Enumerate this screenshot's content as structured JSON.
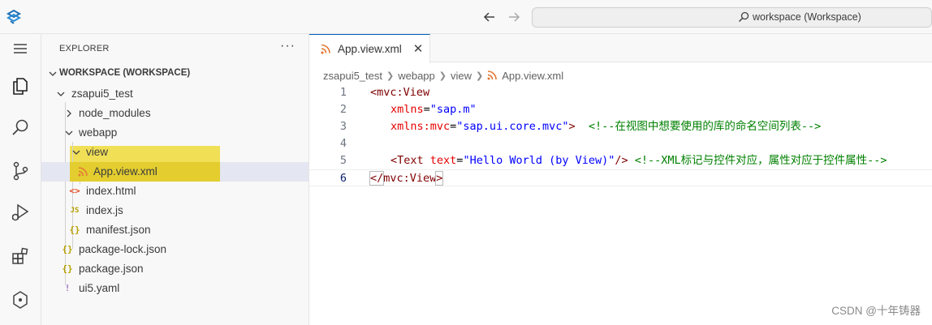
{
  "titlebar": {
    "search_text": "workspace (Workspace)"
  },
  "explorer": {
    "title": "EXPLORER",
    "more_label": "···",
    "section_label": "WORKSPACE (WORKSPACE)",
    "tree": [
      {
        "label": "zsapui5_test",
        "type": "folder-open",
        "icon": "chevron-down-icon"
      },
      {
        "label": "node_modules",
        "type": "folder-closed",
        "icon": "chevron-right-icon"
      },
      {
        "label": "webapp",
        "type": "folder-open",
        "icon": "chevron-down-icon"
      },
      {
        "label": "view",
        "type": "folder-open",
        "icon": "chevron-down-icon"
      },
      {
        "label": "App.view.xml",
        "type": "file",
        "icon": "rss-xml-icon",
        "glyph": "ʃ"
      },
      {
        "label": "index.html",
        "type": "file",
        "icon": "html-icon",
        "glyph": "<>"
      },
      {
        "label": "index.js",
        "type": "file",
        "icon": "js-icon",
        "glyph": "JS"
      },
      {
        "label": "manifest.json",
        "type": "file",
        "icon": "json-icon",
        "glyph": "{}"
      },
      {
        "label": "package-lock.json",
        "type": "file",
        "icon": "json-icon",
        "glyph": "{}"
      },
      {
        "label": "package.json",
        "type": "file",
        "icon": "json-icon",
        "glyph": "{}"
      },
      {
        "label": "ui5.yaml",
        "type": "file",
        "icon": "yaml-icon",
        "glyph": "!"
      }
    ]
  },
  "editor": {
    "tab_label": "App.view.xml",
    "tab_close": "✕",
    "breadcrumbs": [
      "zsapui5_test",
      "webapp",
      "view",
      "App.view.xml"
    ],
    "lines": [
      {
        "n": "1"
      },
      {
        "n": "2"
      },
      {
        "n": "3"
      },
      {
        "n": "4"
      },
      {
        "n": "5"
      },
      {
        "n": "6"
      }
    ],
    "code": {
      "l1_tag": "<mvc:View",
      "l2_attr": "xmlns",
      "l2_eq": "=",
      "l2_val": "\"sap.m\"",
      "l3_attr": "xmlns:mvc",
      "l3_eq": "=",
      "l3_val": "\"sap.ui.core.mvc\"",
      "l3_close": ">",
      "l3_comment": "<!--在视图中想要使用的库的命名空间列表-->",
      "l5_tag": "<Text",
      "l5_attr": "text",
      "l5_eq": "=",
      "l5_val": "\"Hello World (by View)\"",
      "l5_close": "/>",
      "l5_comment": "<!--XML标记与控件对应，属性对应于控件属性-->",
      "l6_open": "</",
      "l6_tag": "mvc:View",
      "l6_close": ">"
    }
  },
  "watermark": "CSDN @十年铸器",
  "colors": {
    "accent": "#005fb8",
    "highlight": "#f0dc39",
    "xml_icon": "#e37933"
  }
}
